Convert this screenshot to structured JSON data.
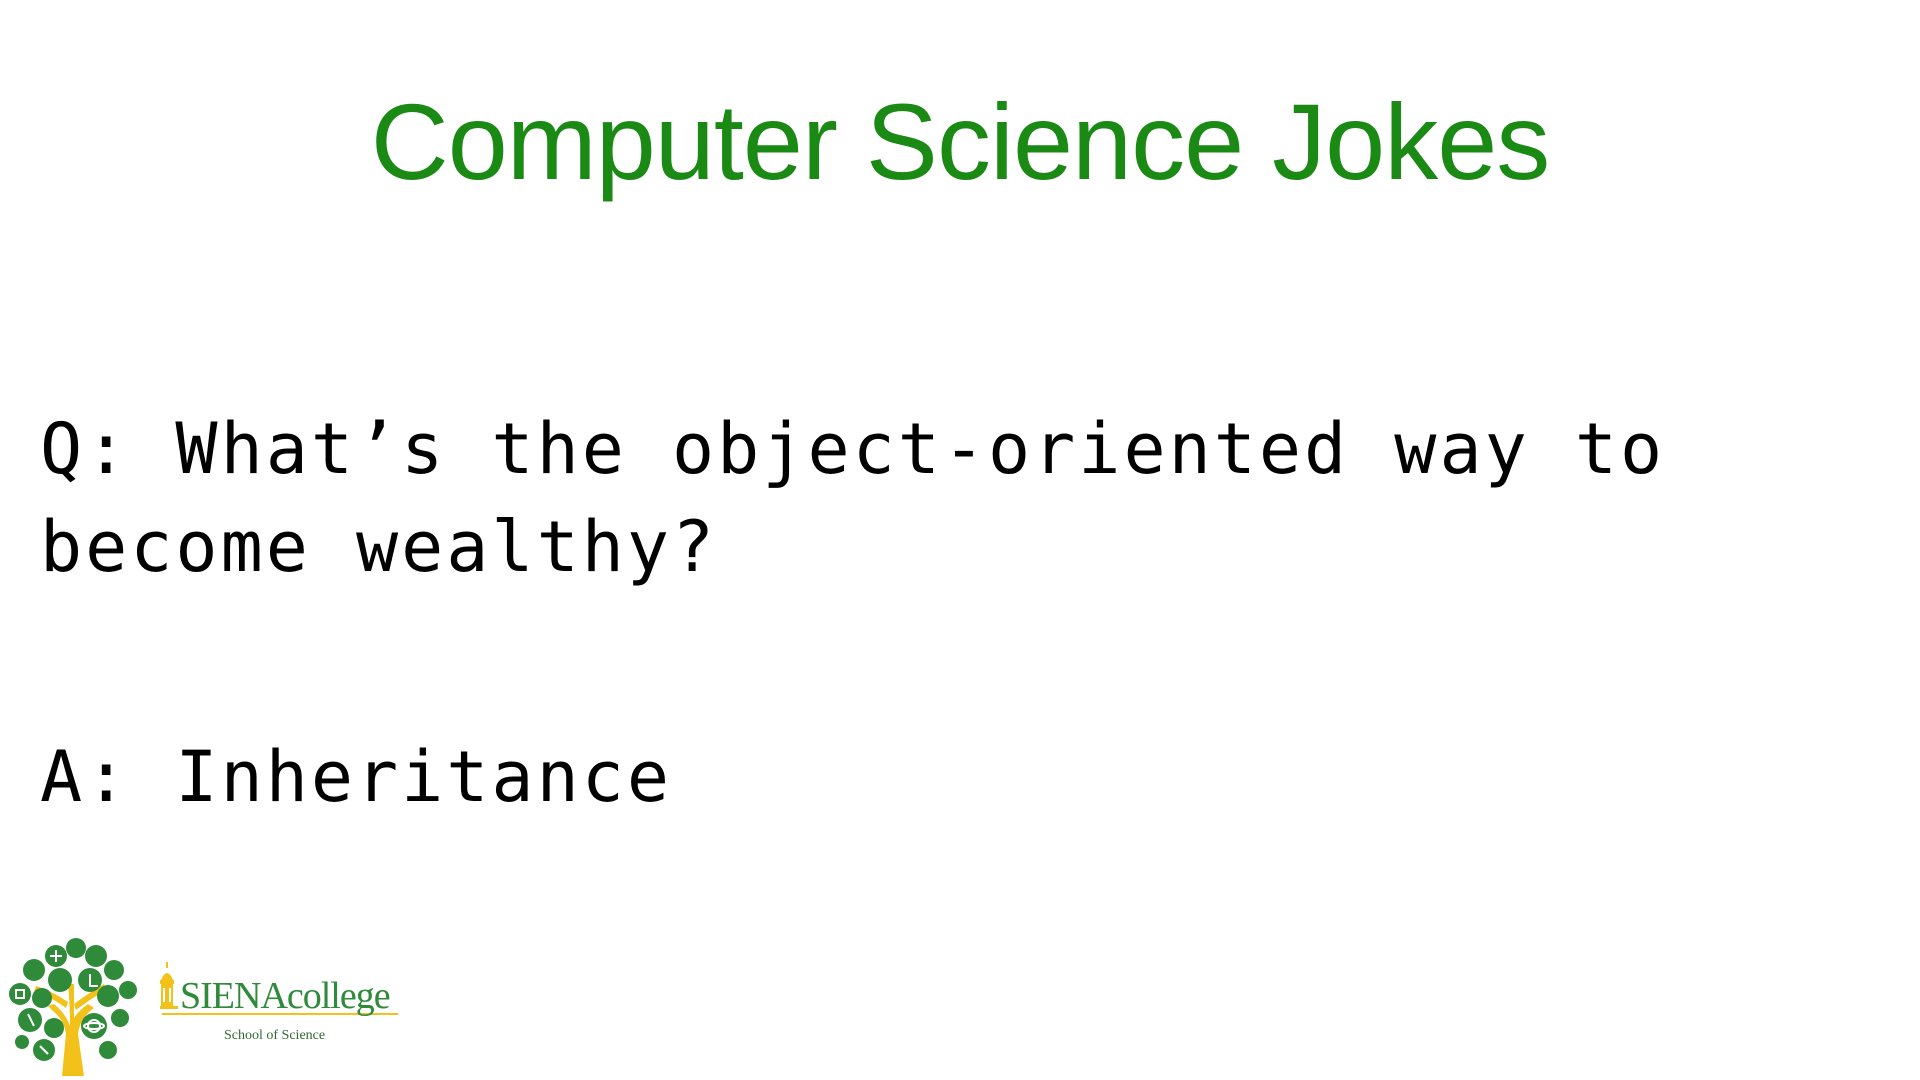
{
  "slide": {
    "title": "Computer Science Jokes",
    "question": "Q: What’s the object-oriented way to become wealthy?",
    "answer": "A: Inheritance"
  },
  "footer": {
    "school_wordmark": "SIENAcollege",
    "school_subtitle": "School of Science",
    "tree_logo_icon": "science-tree-icon",
    "dome_icon": "dome-building-icon"
  },
  "colors": {
    "title_green": "#1a8a14",
    "logo_green": "#2f8a3a",
    "logo_gold": "#f2c21b",
    "text_black": "#000000"
  }
}
